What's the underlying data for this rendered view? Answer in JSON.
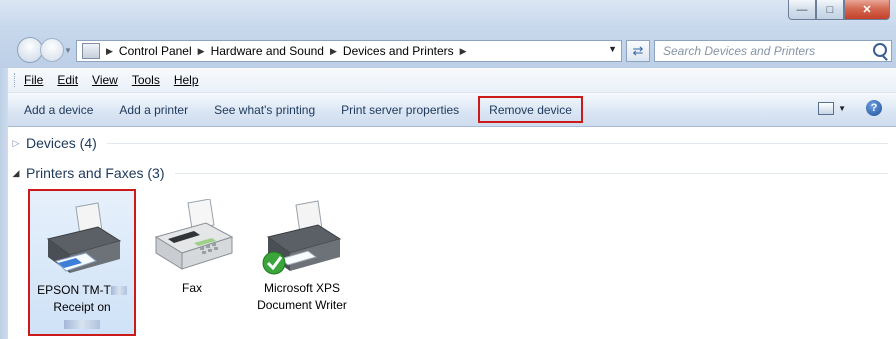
{
  "address": {
    "crumbs": [
      "Control Panel",
      "Hardware and Sound",
      "Devices and Printers"
    ]
  },
  "search": {
    "placeholder": "Search Devices and Printers"
  },
  "menu": {
    "items": [
      "File",
      "Edit",
      "View",
      "Tools",
      "Help"
    ]
  },
  "toolbar": {
    "add_device": "Add a device",
    "add_printer": "Add a printer",
    "see_printing": "See what's printing",
    "print_server": "Print server properties",
    "remove_device": "Remove device"
  },
  "groups": {
    "devices": "Devices (4)",
    "printers": "Printers and Faxes (3)"
  },
  "printers": [
    {
      "line1": "EPSON TM-T",
      "line2": "Receipt on"
    },
    {
      "line1": "Fax",
      "line2": ""
    },
    {
      "line1": "Microsoft XPS",
      "line2": "Document Writer"
    }
  ],
  "colors": {
    "highlight_border": "#cc1a1a",
    "default_badge": "#2f9c2f"
  }
}
